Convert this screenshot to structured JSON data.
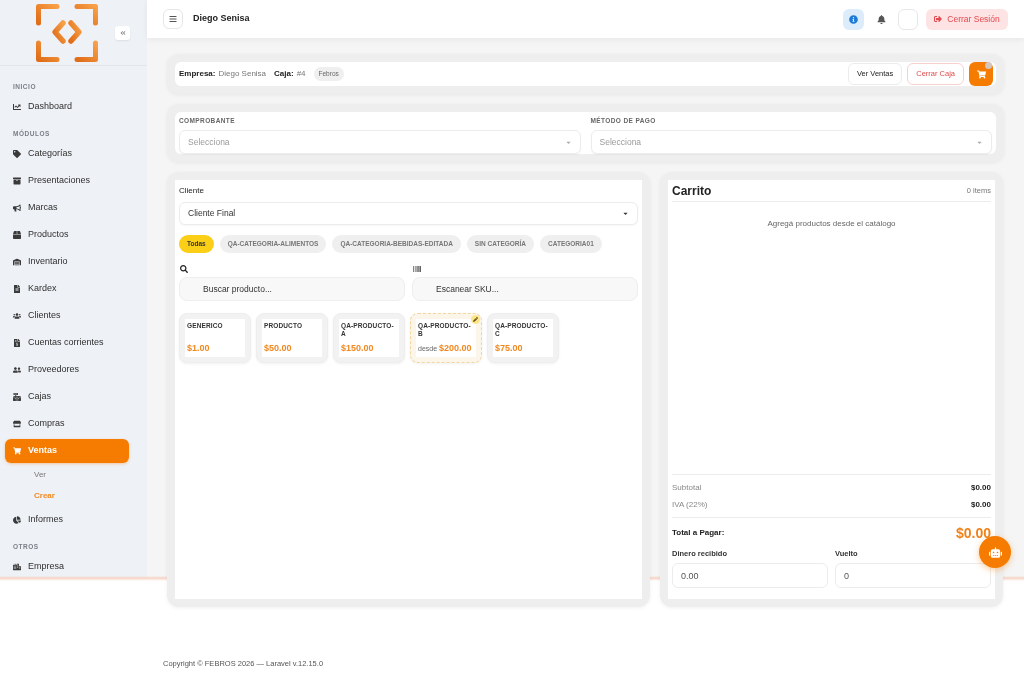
{
  "sidebar": {
    "sections": [
      {
        "label": "INICIO",
        "items": [
          {
            "label": "Dashboard",
            "selected": false
          }
        ]
      },
      {
        "label": "MÓDULOS",
        "items": [
          {
            "label": "Categorías",
            "selected": false
          },
          {
            "label": "Presentaciones",
            "selected": false
          },
          {
            "label": "Marcas",
            "selected": false
          },
          {
            "label": "Productos",
            "selected": false
          },
          {
            "label": "Inventario",
            "selected": false
          },
          {
            "label": "Kardex",
            "selected": false
          },
          {
            "label": "Clientes",
            "selected": false
          },
          {
            "label": "Cuentas corrientes",
            "selected": false
          },
          {
            "label": "Proveedores",
            "selected": false
          },
          {
            "label": "Cajas",
            "selected": false
          },
          {
            "label": "Compras",
            "selected": false
          },
          {
            "label": "Ventas",
            "selected": true,
            "children": [
              {
                "label": "Ver",
                "selected": false
              },
              {
                "label": "Crear",
                "selected": true
              }
            ]
          },
          {
            "label": "Informes",
            "selected": false
          }
        ]
      },
      {
        "label": "OTROS",
        "items": [
          {
            "label": "Empresa",
            "selected": false
          }
        ]
      }
    ]
  },
  "topbar": {
    "user": "Diego Senisa",
    "logout": "Cerrar Sesión"
  },
  "session_bar": {
    "company_label": "Empresa:",
    "company": "Diego Senisa",
    "register_label": "Caja:",
    "register": "#4",
    "tag": "Febros",
    "actions": [
      {
        "label": "Ver Ventas",
        "kind": "default"
      },
      {
        "label": "Cerrar Caja",
        "kind": "danger"
      }
    ]
  },
  "payment": {
    "fields": [
      {
        "label": "COMPROBANTE",
        "placeholder": "Selecciona"
      },
      {
        "label": "MÉTODO DE PAGO",
        "placeholder": "Selecciona"
      }
    ]
  },
  "catalog": {
    "client_label": "Cliente",
    "client_value": "Cliente Final",
    "categories": [
      {
        "label": "Todas",
        "selected": true
      },
      {
        "label": "QA-CATEGORIA-ALIMENTOS",
        "selected": false
      },
      {
        "label": "QA-CATEGORIA-BEBIDAS-EDITADA",
        "selected": false
      },
      {
        "label": "SIN CATEGORÍA",
        "selected": false
      },
      {
        "label": "CATEGORIA01",
        "selected": false
      }
    ],
    "search": {
      "placeholder": "Buscar producto..."
    },
    "sku": {
      "placeholder": "Escanear SKU..."
    },
    "products": [
      {
        "name": "GENERICO",
        "price": "$1.00",
        "kind": "simple"
      },
      {
        "name": "PRODUCTO",
        "price": "$50.00",
        "kind": "simple"
      },
      {
        "name": "QA-PRODUCTO-A",
        "price": "$150.00",
        "kind": "simple"
      },
      {
        "name": "QA-PRODUCTO-B",
        "price_prefix": "desde",
        "price": "$200.00",
        "kind": "variable"
      },
      {
        "name": "QA-PRODUCTO-C",
        "price": "$75.00",
        "kind": "simple"
      }
    ]
  },
  "cart": {
    "title": "Carrito",
    "count": "0 items",
    "empty_message": "Agregá productos desde el catálogo",
    "totals": [
      {
        "label": "Subtotal",
        "value": "$0.00"
      },
      {
        "label": "IVA (22%)",
        "value": "$0.00"
      }
    ],
    "total": {
      "label": "Total a Pagar:",
      "value": "$0.00"
    },
    "received": {
      "label": "Dinero recibido",
      "value": "0.00"
    },
    "change": {
      "label": "Vuelto",
      "value": "0"
    }
  },
  "footer": "Copyright © FEBROS 2026 — Laravel v.12.15.0"
}
